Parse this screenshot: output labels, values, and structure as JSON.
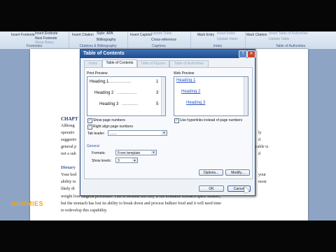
{
  "ribbon": {
    "footnotes_group": {
      "insert_footnote": "Insert\nFootnote",
      "insert_endnote": "Insert Endnote",
      "next_footnote": "Next Footnote",
      "show_notes": "Show Notes",
      "label": "Footnotes"
    },
    "citations_group": {
      "insert_citation": "Insert\nCitation",
      "style_label": "Style:",
      "style_value": "APA",
      "bibliography": "Bibliography",
      "label": "Citations & Bibliography"
    },
    "captions_group": {
      "insert_caption": "Insert\nCaption",
      "update_table": "Update Table",
      "cross_reference": "Cross-reference",
      "label": "Captions"
    },
    "index_group": {
      "mark_entry": "Mark\nEntry",
      "insert_index": "Insert Index",
      "update_index": "Update Index",
      "label": "Index"
    },
    "authorities_group": {
      "mark_citation": "Mark\nCitation",
      "insert_toa": "Insert Table of Authorities",
      "update_table": "Update Table",
      "label": "Table of Authorities"
    }
  },
  "document": {
    "chapter_heading": "CHAPT",
    "para1": [
      "Althoug",
      "operativ",
      "suggestiv",
      "general p",
      "not a sub"
    ],
    "para1_right": [
      "ly",
      "d",
      "cable is",
      "d"
    ],
    "sub_heading": "Dietary",
    "para2": [
      "Your bod",
      "ability to",
      "likely di",
      "weight loss surgical procedure. This is because not only is the available stomach space smaller,",
      "but the stomach has lost its ability to break down and process bulkier food and it will need time",
      "to redevelop this capability."
    ],
    "para2_right": [
      "your",
      "most",
      ""
    ]
  },
  "watermark": "DUMMIES",
  "dialog": {
    "title": "Table of Contents",
    "help_glyph": "?",
    "close_glyph": "✕",
    "tabs": [
      "Index",
      "Table of Contents",
      "Table of Figures",
      "Table of Authorities"
    ],
    "active_tab": "Table of Contents",
    "print_preview_label": "Print Preview",
    "web_preview_label": "Web Preview",
    "print_preview_rows": [
      "Heading 1",
      "Heading 2",
      "Heading 3"
    ],
    "print_preview_pages": [
      "1",
      "3",
      "5"
    ],
    "web_preview_links": [
      "Heading 1",
      "Heading 2",
      "Heading 3"
    ],
    "show_page_numbers": "Show page numbers",
    "right_align": "Right align page numbers",
    "tab_leader_label": "Tab leader:",
    "tab_leader_value": ".......",
    "use_hyperlinks": "Use hyperlinks instead of page numbers",
    "general_label": "General",
    "formats_label": "Formats:",
    "formats_value": "From template",
    "show_levels_label": "Show levels:",
    "show_levels_value": "3",
    "options_button": "Options...",
    "modify_button": "Modify...",
    "ok_button": "OK",
    "cancel_button": "Cancel"
  },
  "colors": {
    "title_bar": "#1e4c8f",
    "document_bg": "#8da4c4",
    "heading_blue": "#1a3a7a",
    "link_blue": "#2a55c4"
  }
}
